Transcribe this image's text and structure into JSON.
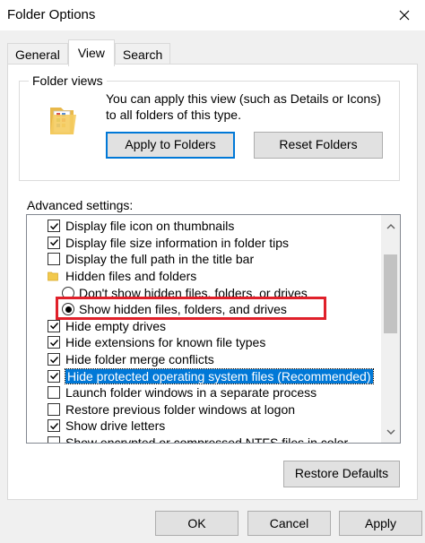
{
  "window": {
    "title": "Folder Options"
  },
  "tabs": [
    {
      "label": "General",
      "active": false
    },
    {
      "label": "View",
      "active": true
    },
    {
      "label": "Search",
      "active": false
    }
  ],
  "folder_views": {
    "legend": "Folder views",
    "description": "You can apply this view (such as Details or Icons) to all folders of this type.",
    "apply_label": "Apply to Folders",
    "reset_label": "Reset Folders"
  },
  "advanced": {
    "label": "Advanced settings:",
    "items": [
      {
        "type": "checkbox",
        "checked": true,
        "indent": 1,
        "label": "Display file icon on thumbnails"
      },
      {
        "type": "checkbox",
        "checked": true,
        "indent": 1,
        "label": "Display file size information in folder tips"
      },
      {
        "type": "checkbox",
        "checked": false,
        "indent": 1,
        "label": "Display the full path in the title bar"
      },
      {
        "type": "folder",
        "indent": 1,
        "label": "Hidden files and folders"
      },
      {
        "type": "radio",
        "checked": false,
        "indent": 2,
        "label": "Don't show hidden files, folders, or drives"
      },
      {
        "type": "radio",
        "checked": true,
        "indent": 2,
        "label": "Show hidden files, folders, and drives"
      },
      {
        "type": "checkbox",
        "checked": true,
        "indent": 1,
        "label": "Hide empty drives"
      },
      {
        "type": "checkbox",
        "checked": true,
        "indent": 1,
        "label": "Hide extensions for known file types"
      },
      {
        "type": "checkbox",
        "checked": true,
        "indent": 1,
        "label": "Hide folder merge conflicts"
      },
      {
        "type": "checkbox",
        "checked": true,
        "indent": 1,
        "label": "Hide protected operating system files (Recommended)",
        "selected": true
      },
      {
        "type": "checkbox",
        "checked": false,
        "indent": 1,
        "label": "Launch folder windows in a separate process"
      },
      {
        "type": "checkbox",
        "checked": false,
        "indent": 1,
        "label": "Restore previous folder windows at logon"
      },
      {
        "type": "checkbox",
        "checked": true,
        "indent": 1,
        "label": "Show drive letters"
      },
      {
        "type": "checkbox",
        "checked": false,
        "indent": 1,
        "label": "Show encrypted or compressed NTFS files in color"
      }
    ],
    "restore_defaults_label": "Restore Defaults"
  },
  "footer": {
    "ok_label": "OK",
    "cancel_label": "Cancel",
    "apply_label": "Apply"
  },
  "colors": {
    "accent": "#0078d7",
    "annotation": "#e0202a"
  }
}
